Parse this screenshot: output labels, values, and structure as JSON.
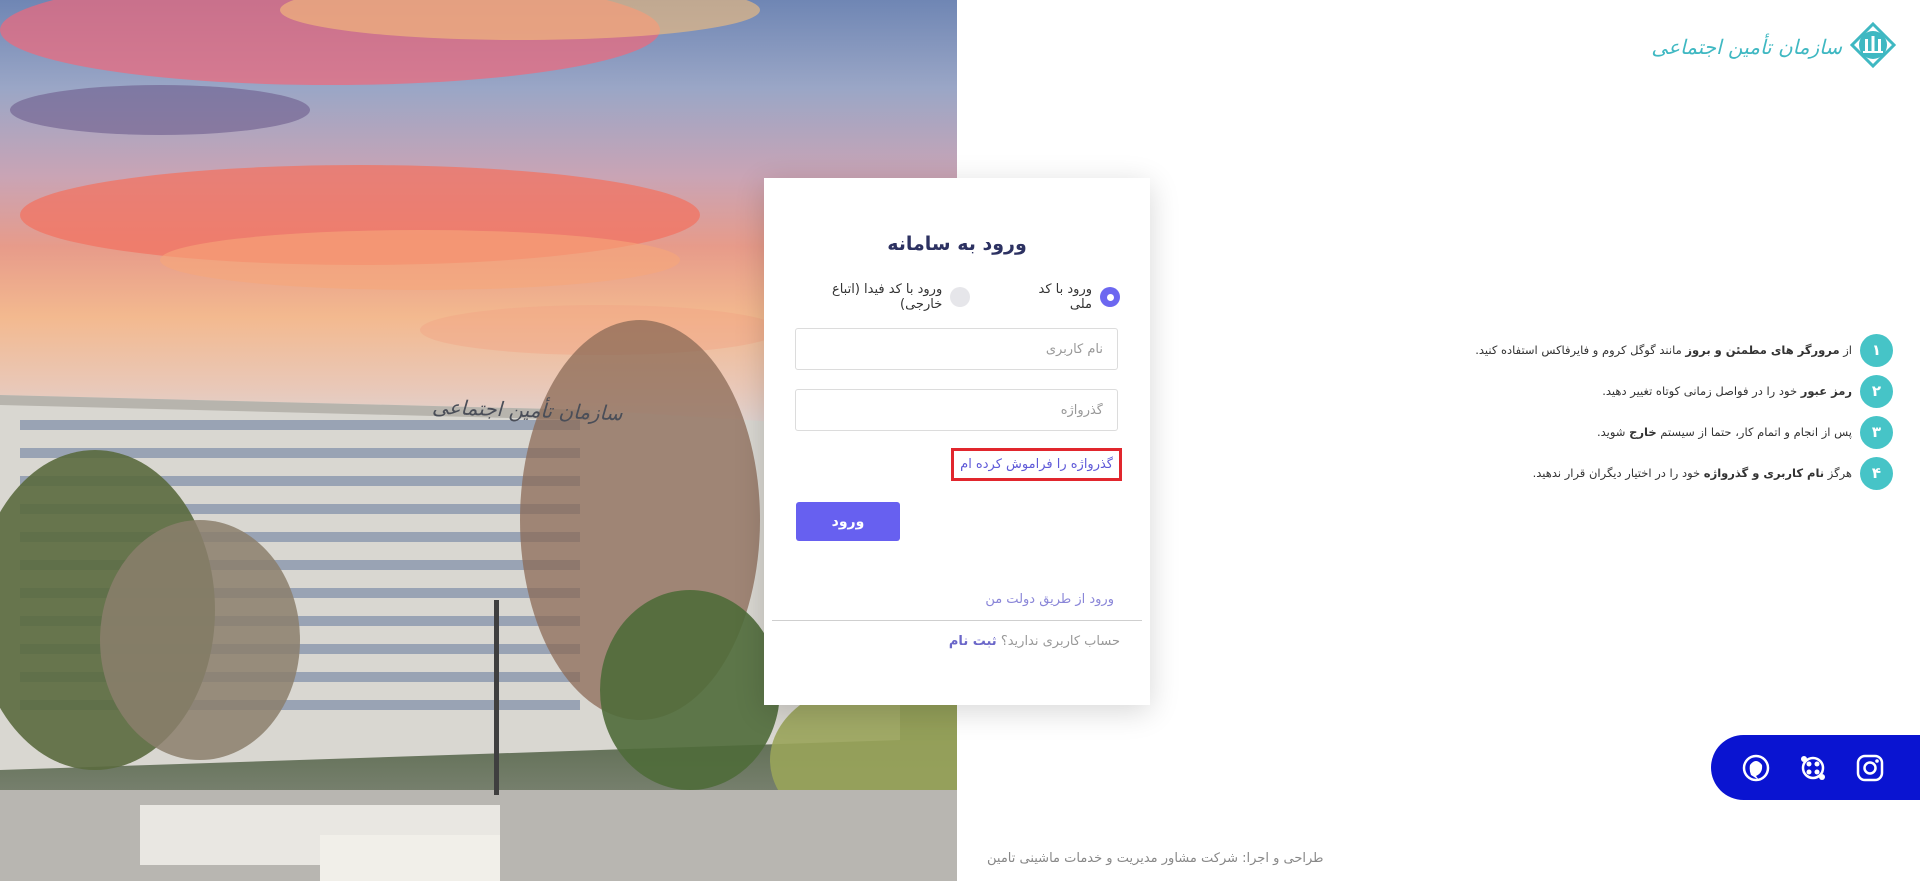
{
  "logo": {
    "text": "سازمان تأمین اجتماعی"
  },
  "photo": {
    "building_sign": "سازمان تأمین اجتماعی"
  },
  "login": {
    "title": "ورود به سامانه",
    "radio_national": "ورود با کد ملی",
    "radio_fida": "ورود با کد فیدا (اتباع خارجی)",
    "username_placeholder": "نام کاربری",
    "password_placeholder": "گذرواژه",
    "forgot_link": "گذرواژه را فراموش کرده ام",
    "submit_label": "ورود",
    "dolat_link": "ورود از طریق دولت من",
    "no_account_text": "حساب کاربری ندارید؟",
    "signup_link": "ثبت نام"
  },
  "tips": [
    {
      "num": "۱",
      "pre": "از ",
      "bold": "مرورگر های مطمئن و بروز",
      "post": " مانند گوگل کروم و فایرفاکس استفاده کنید."
    },
    {
      "num": "۲",
      "pre": "",
      "bold": "رمز عبور",
      "post": " خود را در فواصل زمانی کوتاه تغییر دهید."
    },
    {
      "num": "۳",
      "pre": "پس از انجام و اتمام کار، حتما از سیستم ",
      "bold": "خارج",
      "post": " شوید."
    },
    {
      "num": "۴",
      "pre": "هرگز ",
      "bold": "نام کاربری و گذرواژه",
      "post": " خود را در اختیار دیگران قرار ندهید."
    }
  ],
  "social": {
    "icons": [
      "instagram-icon",
      "aparat-icon",
      "soroush-icon"
    ]
  },
  "footer": {
    "credit": "طراحی و اجرا: شرکت مشاور مدیریت و خدمات ماشینی تامین"
  },
  "colors": {
    "primary": "#6760f0",
    "teal": "#46c4c7",
    "social_bg": "#0a14d1",
    "highlight_border": "#e1262d"
  }
}
